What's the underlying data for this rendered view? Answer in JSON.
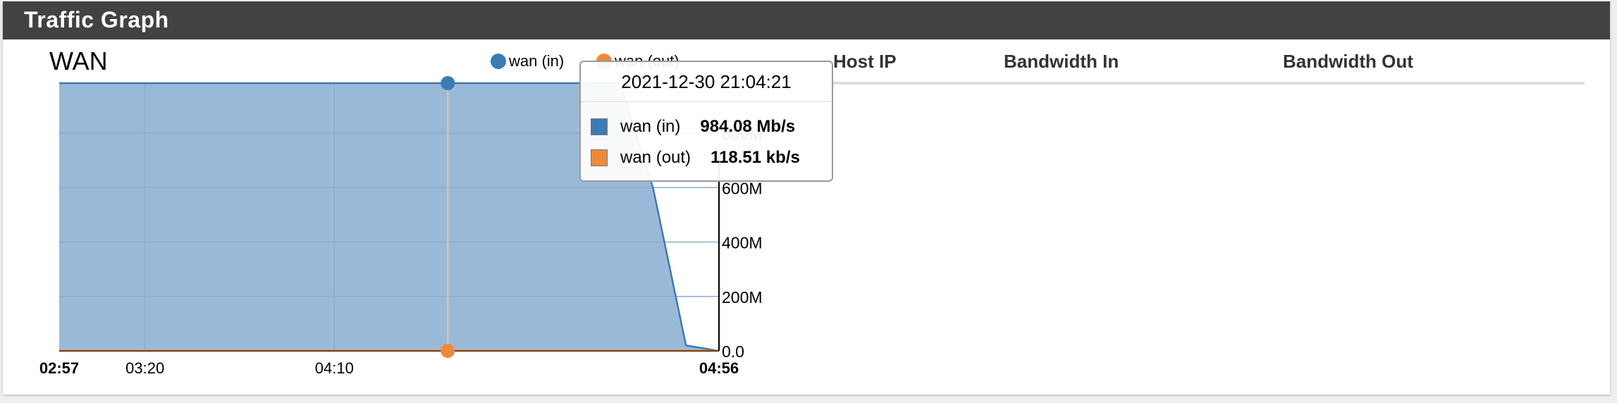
{
  "panel": {
    "title": "Traffic Graph"
  },
  "graph": {
    "title": "WAN",
    "legend": [
      {
        "label": "wan (in)",
        "color": "#3b7bb5"
      },
      {
        "label": "wan (out)",
        "color": "#f0883a"
      }
    ]
  },
  "table": {
    "headers": [
      "Host IP",
      "Bandwidth In",
      "Bandwidth Out"
    ]
  },
  "tooltip": {
    "timestamp": "2021-12-30 21:04:21",
    "rows": [
      {
        "label": "wan (in)",
        "value": "984.08 Mb/s",
        "color": "#3b7bb5"
      },
      {
        "label": "wan (out)",
        "value": "118.51 kb/s",
        "color": "#f0883a"
      }
    ]
  },
  "chart_data": {
    "type": "area",
    "x_ticks": [
      "02:57",
      "03:20",
      "04:10",
      "04:56"
    ],
    "y_ticks": [
      "0.0",
      "200M",
      "400M",
      "600M",
      "800M"
    ],
    "ylim": [
      0,
      984
    ],
    "grid": true,
    "series": [
      {
        "name": "wan (in)",
        "color": "#3b7bb5",
        "x": [
          0,
          0.05,
          0.5,
          0.85,
          0.9,
          0.95,
          1.0
        ],
        "y": [
          984,
          984,
          984,
          984,
          600,
          20,
          0
        ]
      },
      {
        "name": "wan (out)",
        "color": "#f0883a",
        "x": [
          0,
          1.0
        ],
        "y": [
          0.12,
          0.12
        ]
      }
    ],
    "hover_x": 0.589
  }
}
